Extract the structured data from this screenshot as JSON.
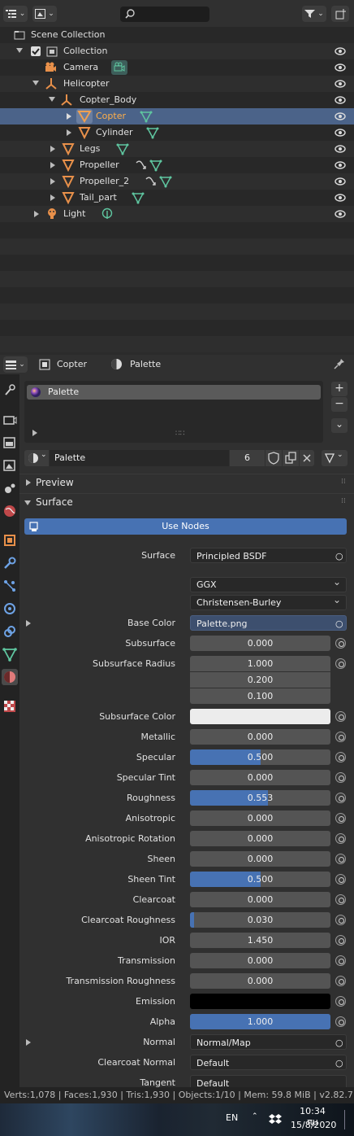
{
  "outliner": {
    "rows": [
      {
        "label": "Scene Collection"
      },
      {
        "label": "Collection"
      },
      {
        "label": "Camera"
      },
      {
        "label": "Helicopter"
      },
      {
        "label": "Copter_Body"
      },
      {
        "label": "Copter"
      },
      {
        "label": "Cylinder"
      },
      {
        "label": "Legs"
      },
      {
        "label": "Propeller"
      },
      {
        "label": "Propeller_2"
      },
      {
        "label": "Tail_part"
      },
      {
        "label": "Light"
      }
    ]
  },
  "props_header": {
    "object": "Copter",
    "material": "Palette"
  },
  "slot": {
    "name": "Palette"
  },
  "material": {
    "name": "Palette",
    "users": "6"
  },
  "panels": {
    "preview": "Preview",
    "surface": "Surface"
  },
  "use_nodes": "Use Nodes",
  "surface": {
    "label": "Surface",
    "value": "Principled BSDF",
    "distribution": "GGX",
    "subsurface_method": "Christensen-Burley",
    "base_color_label": "Base Color",
    "base_color_value": "Palette.png",
    "subsurface_radius_label": "Subsurface Radius",
    "subsurface_radius": [
      "1.000",
      "0.200",
      "0.100"
    ],
    "subsurface_color_label": "Subsurface Color",
    "params": [
      {
        "label": "Subsurface",
        "value": "0.000",
        "fraction": 0
      },
      {
        "label": "Metallic",
        "value": "0.000",
        "fraction": 0
      },
      {
        "label": "Specular",
        "value": "0.500",
        "fraction": 0.5
      },
      {
        "label": "Specular Tint",
        "value": "0.000",
        "fraction": 0
      },
      {
        "label": "Roughness",
        "value": "0.553",
        "fraction": 0.553
      },
      {
        "label": "Anisotropic",
        "value": "0.000",
        "fraction": 0
      },
      {
        "label": "Anisotropic Rotation",
        "value": "0.000",
        "fraction": 0
      },
      {
        "label": "Sheen",
        "value": "0.000",
        "fraction": 0
      },
      {
        "label": "Sheen Tint",
        "value": "0.500",
        "fraction": 0.5
      },
      {
        "label": "Clearcoat",
        "value": "0.000",
        "fraction": 0
      },
      {
        "label": "Clearcoat Roughness",
        "value": "0.030",
        "fraction": 0.03
      },
      {
        "label": "IOR",
        "value": "1.450",
        "fraction": 0
      },
      {
        "label": "Transmission",
        "value": "0.000",
        "fraction": 0
      },
      {
        "label": "Transmission Roughness",
        "value": "0.000",
        "fraction": 0
      }
    ],
    "emission_label": "Emission",
    "alpha_label": "Alpha",
    "alpha_value": "1.000",
    "normal_label": "Normal",
    "normal_value": "Normal/Map",
    "clearcoat_normal_label": "Clearcoat Normal",
    "clearcoat_normal_value": "Default",
    "tangent_label": "Tangent",
    "tangent_value": "Default"
  },
  "status_bar": "Verts:1,078 | Faces:1,930 | Tris:1,930 | Objects:1/10 | Mem: 59.8 MiB | v2.82.7",
  "taskbar": {
    "lang": "EN",
    "time": "10:34 πμ",
    "date": "15/8/2020"
  },
  "colors": {
    "accent": "#4772b3",
    "selected_row": "#4b6389",
    "object_orange": "#e8904a",
    "mesh_green": "#5fc6a0"
  }
}
